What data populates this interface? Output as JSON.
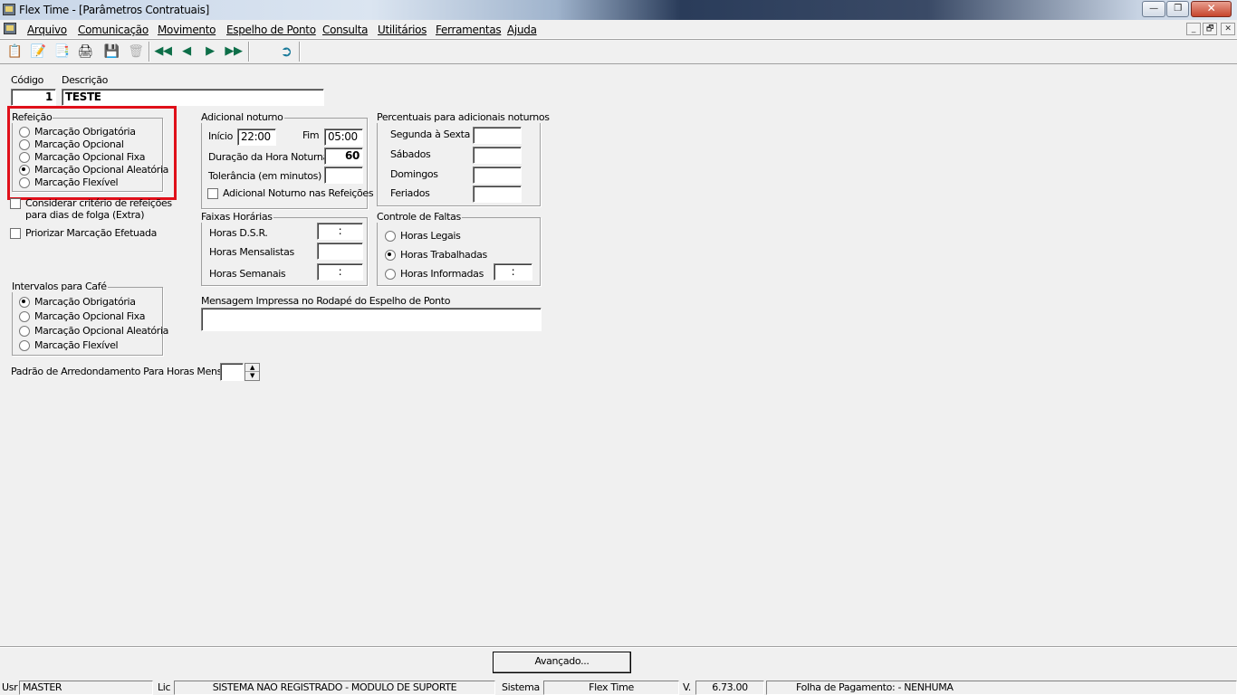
{
  "window": {
    "title": "Flex Time - [Parâmetros Contratuais]",
    "minimize": "—",
    "maximize": "❐",
    "close": "✕"
  },
  "menu": [
    "Arquivo",
    "Comunicação",
    "Movimento",
    "Espelho de Ponto",
    "Consulta",
    "Utilitários",
    "Ferramentas",
    "Ajuda"
  ],
  "mdi_controls": [
    "_",
    "🗗",
    "✕"
  ],
  "toolbar": {
    "icons": [
      "new-record-icon",
      "edit-record-icon",
      "copy-record-icon",
      "print-icon",
      "save-icon",
      "delete-icon",
      "first-record-icon",
      "previous-record-icon",
      "next-record-icon",
      "last-record-icon",
      "exit-icon"
    ]
  },
  "form": {
    "codigo_label": "Código",
    "codigo_value": "1",
    "descricao_label": "Descrição",
    "descricao_value": "TESTE",
    "refeicao": {
      "title": "Refeição",
      "options": [
        "Marcação Obrigatória",
        "Marcação Opcional",
        "Marcação Opcional Fixa",
        "Marcação Opcional Aleatória",
        "Marcação Flexível"
      ],
      "selected": "Marcação Opcional Aleatória"
    },
    "considerar_line1": "Considerar critério de refeições",
    "considerar_line2": "para dias de folga (Extra)",
    "priorizar": "Priorizar Marcação Efetuada",
    "adicional": {
      "title": "Adicional noturno",
      "inicio_label": "Início",
      "inicio_value": "22:00",
      "fim_label": "Fim",
      "fim_value": "05:00",
      "duracao_label": "Duração da Hora Noturna",
      "duracao_value": "60",
      "tolerancia_label": "Tolerância (em minutos)",
      "tolerancia_value": "",
      "refeicoes_check": "Adicional Noturno nas Refeições"
    },
    "percentuais": {
      "title": "Percentuais para adicionais noturnos",
      "rows": [
        "Segunda à Sexta",
        "Sábados",
        "Domingos",
        "Feriados"
      ]
    },
    "faixas": {
      "title": "Faixas Horárias",
      "dsr_label": "Horas D.S.R.",
      "dsr_value": ":",
      "mensalistas_label": "Horas Mensalistas",
      "mensalistas_value": "",
      "semanais_label": "Horas Semanais",
      "semanais_value": ":"
    },
    "faltas": {
      "title": "Controle de Faltas",
      "options": [
        "Horas Legais",
        "Horas Trabalhadas",
        "Horas Informadas"
      ],
      "selected": "Horas Trabalhadas",
      "informadas_value": ":"
    },
    "cafe": {
      "title": "Intervalos para Café",
      "options": [
        "Marcação Obrigatória",
        "Marcação Opcional Fixa",
        "Marcação Opcional Aleatória",
        "Marcação Flexível"
      ],
      "selected": "Marcação Obrigatória"
    },
    "mensagem_label": "Mensagem Impressa no Rodapé do Espelho de Ponto",
    "mensagem_value": "",
    "padrao_label": "Padrão de Arredondamento Para Horas Mensais",
    "padrao_value": ""
  },
  "avancado_button": "Avançado...",
  "statusbar": {
    "usr_label": "Usr",
    "usr_value": "MASTER",
    "lic_label": "Lic",
    "lic_value": "SISTEMA NAO REGISTRADO - MODULO DE SUPORTE",
    "sistema_label": "Sistema",
    "sistema_value": "Flex Time",
    "v_label": "V.",
    "v_value": "6.73.00",
    "folha_value": "Folha de Pagamento:  - NENHUMA"
  },
  "colors": {
    "highlight_box": "#e0101a",
    "toolbar_arrows": "#0d6e48"
  }
}
